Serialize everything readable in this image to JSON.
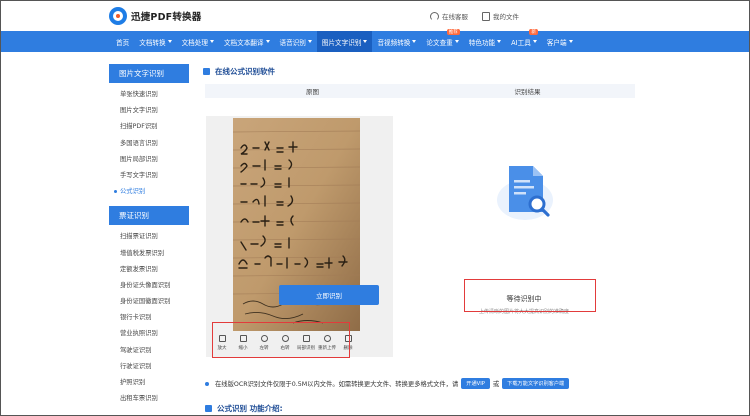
{
  "header": {
    "logo_text": "迅捷PDF转换器",
    "links": [
      {
        "label": "在线客服",
        "icon": "headset-icon"
      },
      {
        "label": "我的文件",
        "icon": "file-icon"
      }
    ]
  },
  "nav": {
    "items": [
      {
        "label": "首页",
        "caret": false
      },
      {
        "label": "文档转换",
        "caret": true
      },
      {
        "label": "文档处理",
        "caret": true
      },
      {
        "label": "文档文本翻译",
        "caret": true
      },
      {
        "label": "语音识别",
        "caret": true
      },
      {
        "label": "图片文字识别",
        "caret": true,
        "active": true
      },
      {
        "label": "音视频转换",
        "caret": true
      },
      {
        "label": "论文查重",
        "caret": true,
        "badge": "推荐"
      },
      {
        "label": "特色功能",
        "caret": true
      },
      {
        "label": "AI工具",
        "caret": true,
        "badge": "新"
      },
      {
        "label": "客户端",
        "caret": true
      }
    ]
  },
  "sidebar": {
    "group1_title": "图片文字识别",
    "group1_items": [
      "单张快速识别",
      "图片文字识别",
      "扫描PDF识别",
      "多国语言识别",
      "图片局部识别",
      "手写文字识别",
      "公式识别"
    ],
    "group1_active": 6,
    "group2_title": "票证识别",
    "group2_items": [
      "扫描票证识别",
      "增值税发票识别",
      "定额发票识别",
      "身份证头像面识别",
      "身份证国徽面识别",
      "银行卡识别",
      "营业执照识别",
      "驾驶证识别",
      "行驶证识别",
      "护照识别",
      "出租车票识别"
    ]
  },
  "main": {
    "section_title": "在线公式识别软件",
    "tab_original": "原图",
    "tab_result": "识别结果",
    "tools": [
      "放大",
      "缩小",
      "左转",
      "右转",
      "局部识别",
      "重新上传",
      "删除"
    ],
    "status_title": "等待识别中",
    "status_sub": "上传清晰的图片将大大提高识别的准确度",
    "recognize_button": "立即识别",
    "notice_text": "在线版OCR识别文件仅限于0.5M以内文件。如需转换更大文件、转换更多格式文件，请",
    "vip_button": "开通VIP",
    "or_text": "或",
    "download_button": "下载万能文字识别客户端",
    "section2_title": "公式识别 功能介绍:"
  },
  "colors": {
    "accent": "#2f7de0",
    "highlight_box": "#e23b3b"
  }
}
